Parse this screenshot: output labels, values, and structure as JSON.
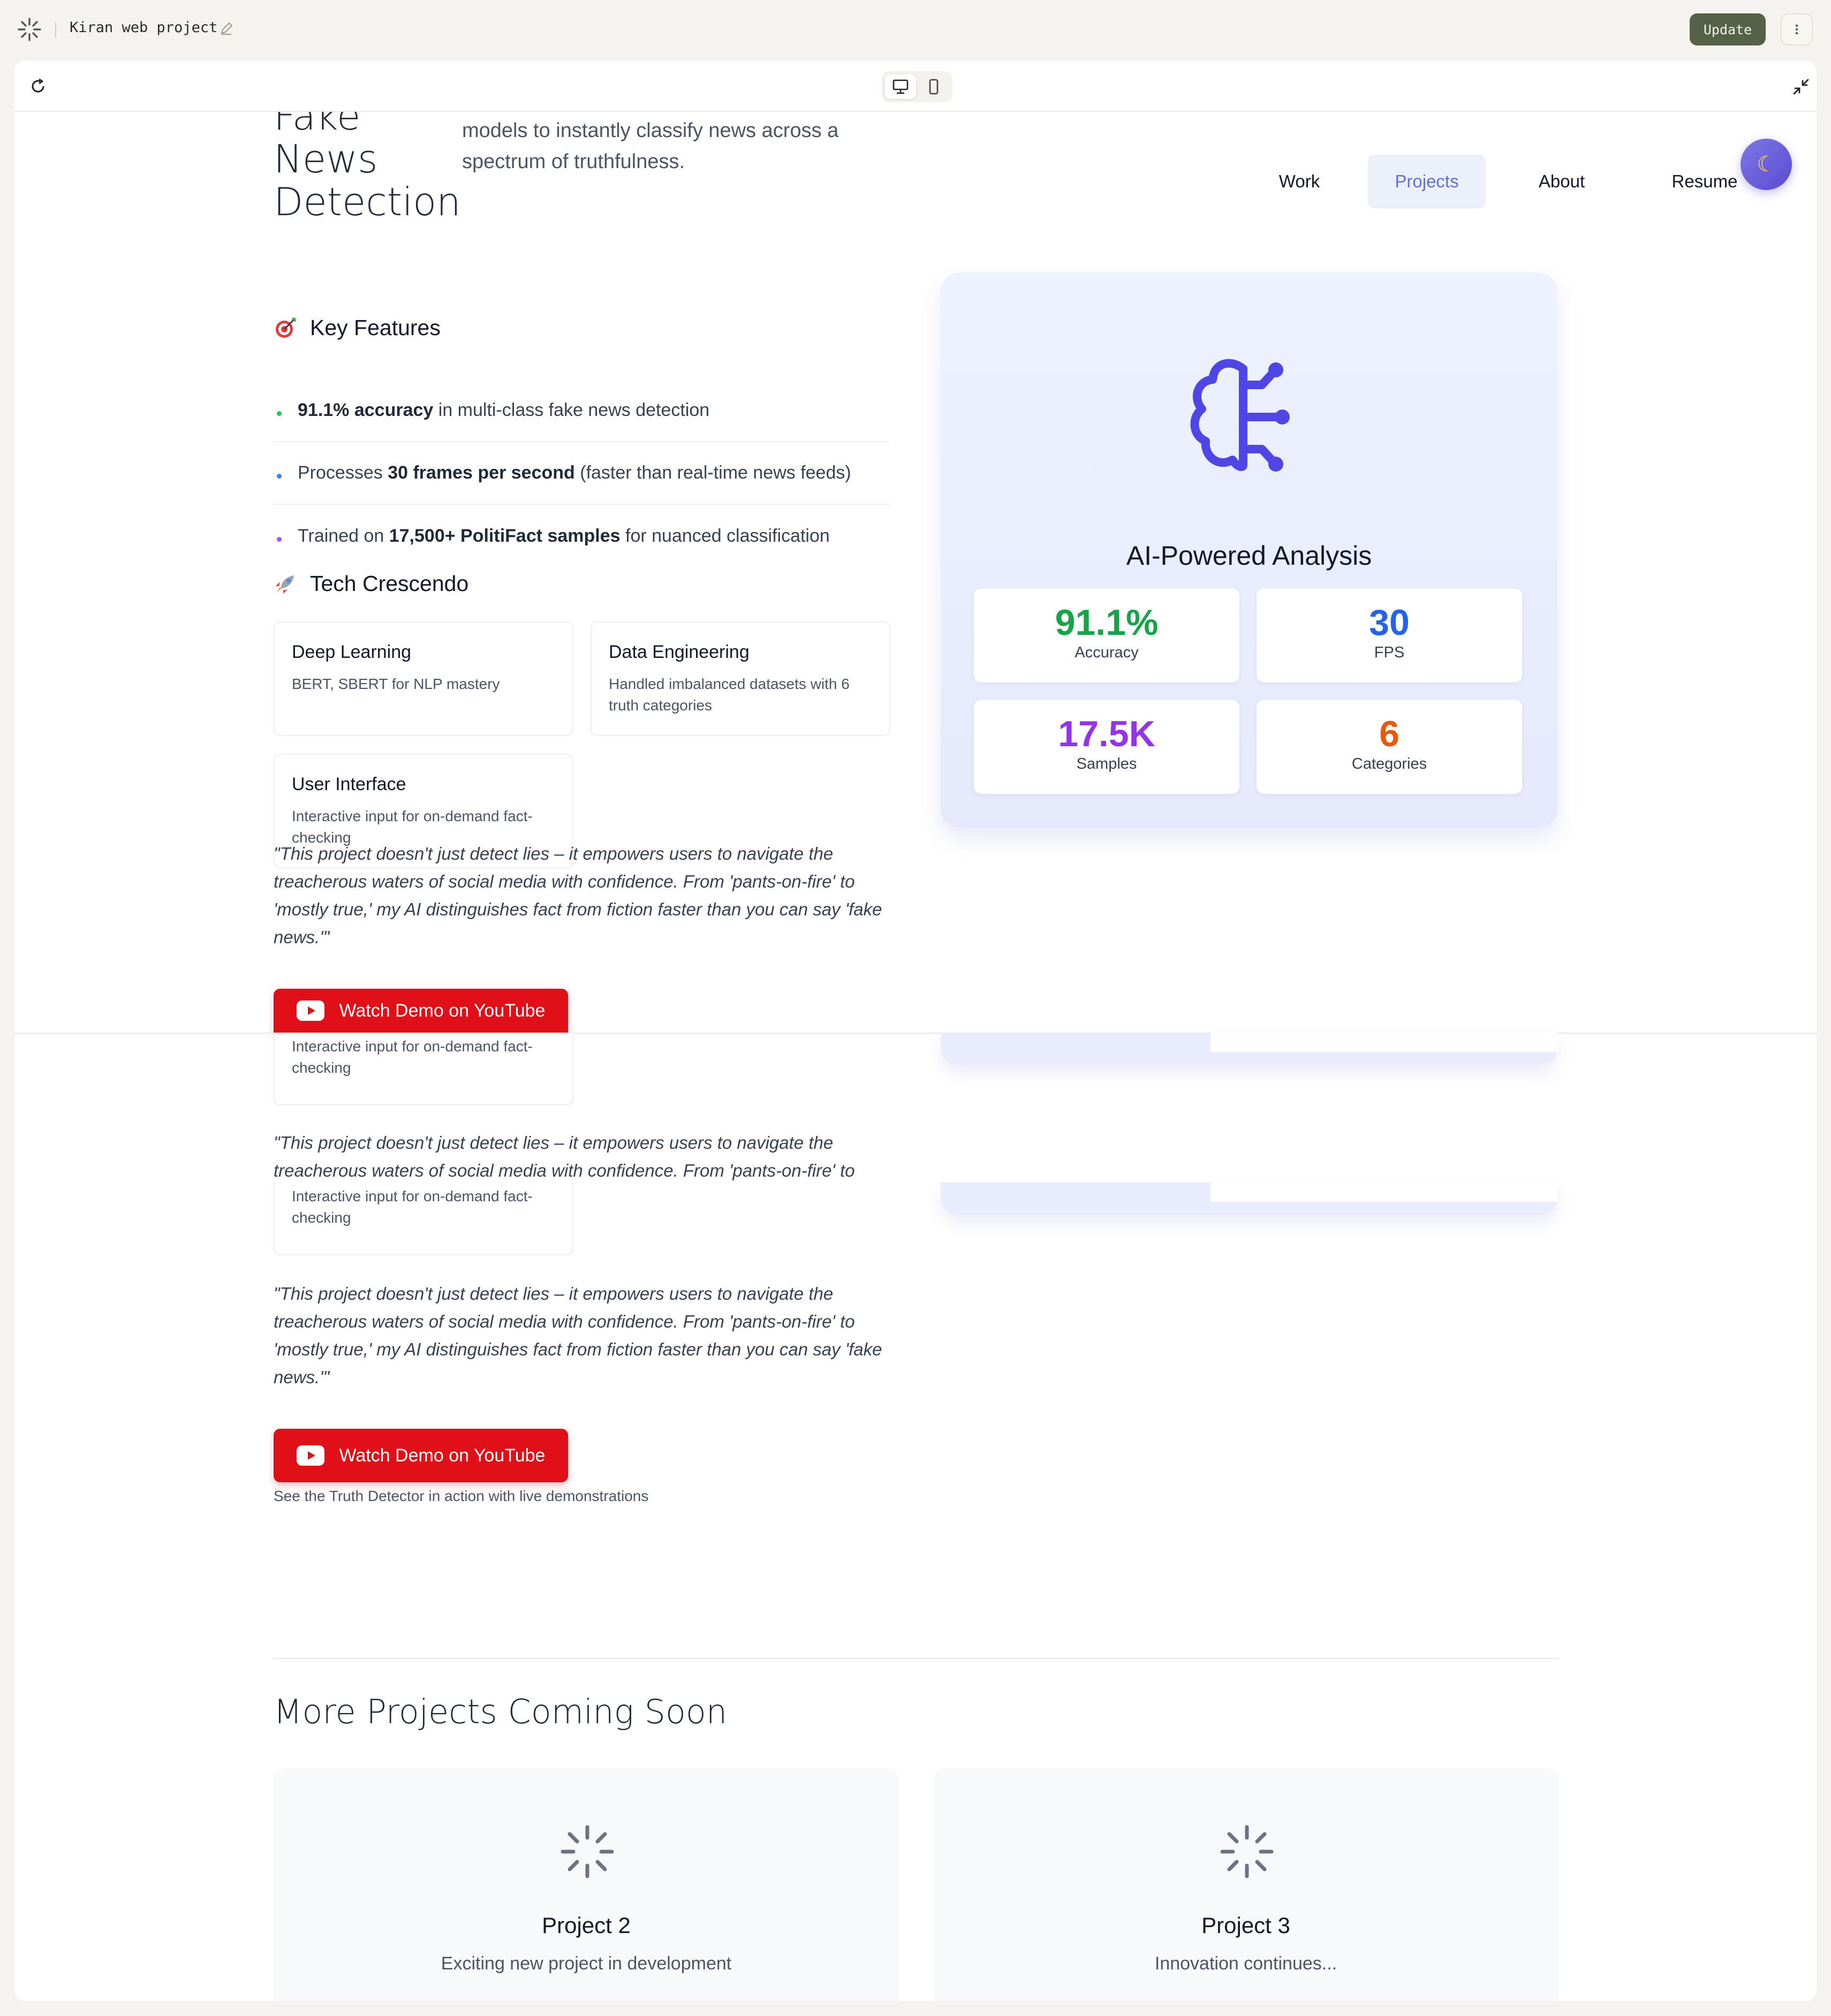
{
  "app": {
    "project_name": "Kiran web project",
    "update_label": "Update"
  },
  "hero": {
    "title_lines": [
      "Fake",
      "News",
      "Detection"
    ],
    "description": "models to instantly classify news across a spectrum of truthfulness."
  },
  "nav": {
    "items": [
      "Work",
      "Projects",
      "About",
      "Resume"
    ],
    "active": "Projects"
  },
  "features": {
    "heading": "Key Features",
    "items": [
      {
        "bold": "91.1% accuracy",
        "pre": "",
        "post": " in multi-class fake news detection",
        "dot_color": "#22c55e"
      },
      {
        "pre": "Processes ",
        "bold": "30 frames per second",
        "post": " (faster than real-time news feeds)",
        "dot_color": "#3b82f6"
      },
      {
        "pre": "Trained on ",
        "bold": "17,500+ PolitiFact samples",
        "post": " for nuanced classification",
        "dot_color": "#a855f7"
      }
    ]
  },
  "tech": {
    "heading": "Tech Crescendo",
    "cards": [
      {
        "title": "Deep Learning",
        "desc": "BERT, SBERT for NLP mastery"
      },
      {
        "title": "Data Engineering",
        "desc": "Handled imbalanced datasets with 6 truth categories"
      },
      {
        "title": "User Interface",
        "desc": "Interactive input for on-demand fact-checking"
      }
    ]
  },
  "quote": {
    "full": "\"This project doesn't just detect lies – it empowers users to navigate the treacherous waters of social media with confidence. From 'pants-on-fire' to 'mostly true,' my AI distinguishes fact from fiction faster than you can say 'fake news.'\"",
    "partial": "\"This project doesn't just detect lies – it empowers users to navigate the treacherous waters of social media with confidence. From 'pants-on-fire' to"
  },
  "cta": {
    "youtube_label": "Watch Demo on YouTube",
    "caption": "See the Truth Detector in action with live demonstrations"
  },
  "analysis": {
    "title": "AI-Powered Analysis",
    "stats": [
      {
        "value": "91.1%",
        "label": "Accuracy",
        "color": "#16a34a"
      },
      {
        "value": "30",
        "label": "FPS",
        "color": "#2563eb"
      },
      {
        "value": "17.5K",
        "label": "Samples",
        "color": "#9333ea"
      },
      {
        "value": "6",
        "label": "Categories",
        "color": "#ea580c"
      }
    ]
  },
  "more": {
    "title": "More Projects Coming Soon",
    "cards": [
      {
        "title": "Project 2",
        "desc": "Exciting new project in development"
      },
      {
        "title": "Project 3",
        "desc": "Innovation continues..."
      }
    ]
  }
}
